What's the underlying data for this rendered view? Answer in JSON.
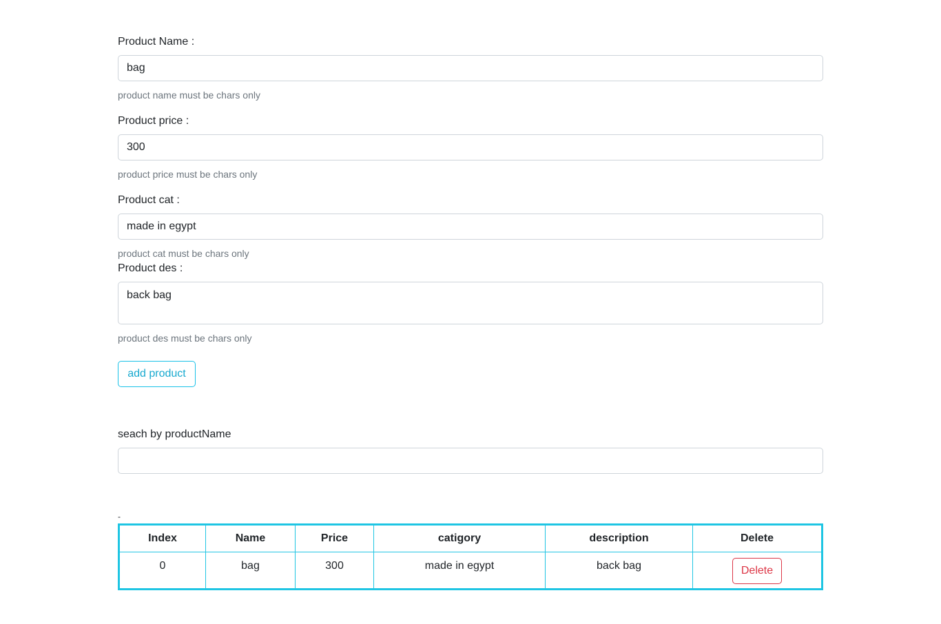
{
  "form": {
    "name": {
      "label": "Product Name :",
      "value": "bag",
      "help": "product name must be chars only"
    },
    "price": {
      "label": "Product price :",
      "value": "300",
      "help": "product price must be chars only"
    },
    "cat": {
      "label": "Product cat :",
      "value": "made in egypt",
      "help": "product cat must be chars only"
    },
    "des": {
      "label": "Product des :",
      "value": "back bag",
      "help": "product des must be chars only"
    },
    "add_button": "add product"
  },
  "search": {
    "label": "seach by productName",
    "value": ""
  },
  "separator": "-",
  "table": {
    "headers": [
      "Index",
      "Name",
      "Price",
      "catigory",
      "description",
      "Delete"
    ],
    "rows": [
      {
        "index": "0",
        "name": "bag",
        "price": "300",
        "category": "made in egypt",
        "description": "back bag",
        "delete_label": "Delete"
      }
    ]
  },
  "colors": {
    "accent": "#1ec5e3",
    "danger": "#dc3545",
    "muted": "#6c757d"
  }
}
